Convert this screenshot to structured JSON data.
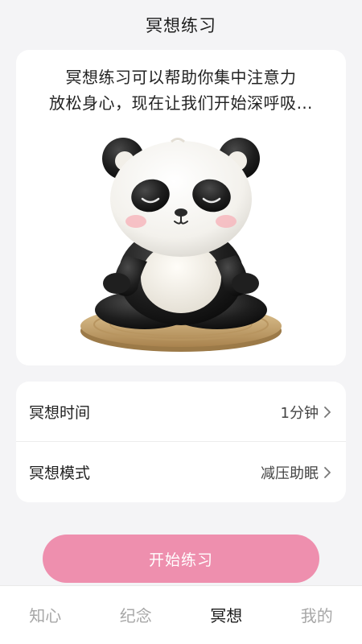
{
  "header": {
    "title": "冥想练习"
  },
  "intro": {
    "line1": "冥想练习可以帮助你集中注意力",
    "line2": "放松身心，现在让我们开始深呼吸…"
  },
  "settings": {
    "duration": {
      "label": "冥想时间",
      "value": "1分钟"
    },
    "mode": {
      "label": "冥想模式",
      "value": "减压助眠"
    }
  },
  "start_button": {
    "label": "开始练习"
  },
  "tabbar": {
    "tabs": [
      {
        "label": "知心",
        "active": false
      },
      {
        "label": "纪念",
        "active": false
      },
      {
        "label": "冥想",
        "active": true
      },
      {
        "label": "我的",
        "active": false
      }
    ]
  },
  "colors": {
    "accent": "#ee8fae",
    "background": "#f4f4f6",
    "tab_active": "#1c1c1c",
    "tab_inactive": "#a7a7a7"
  }
}
